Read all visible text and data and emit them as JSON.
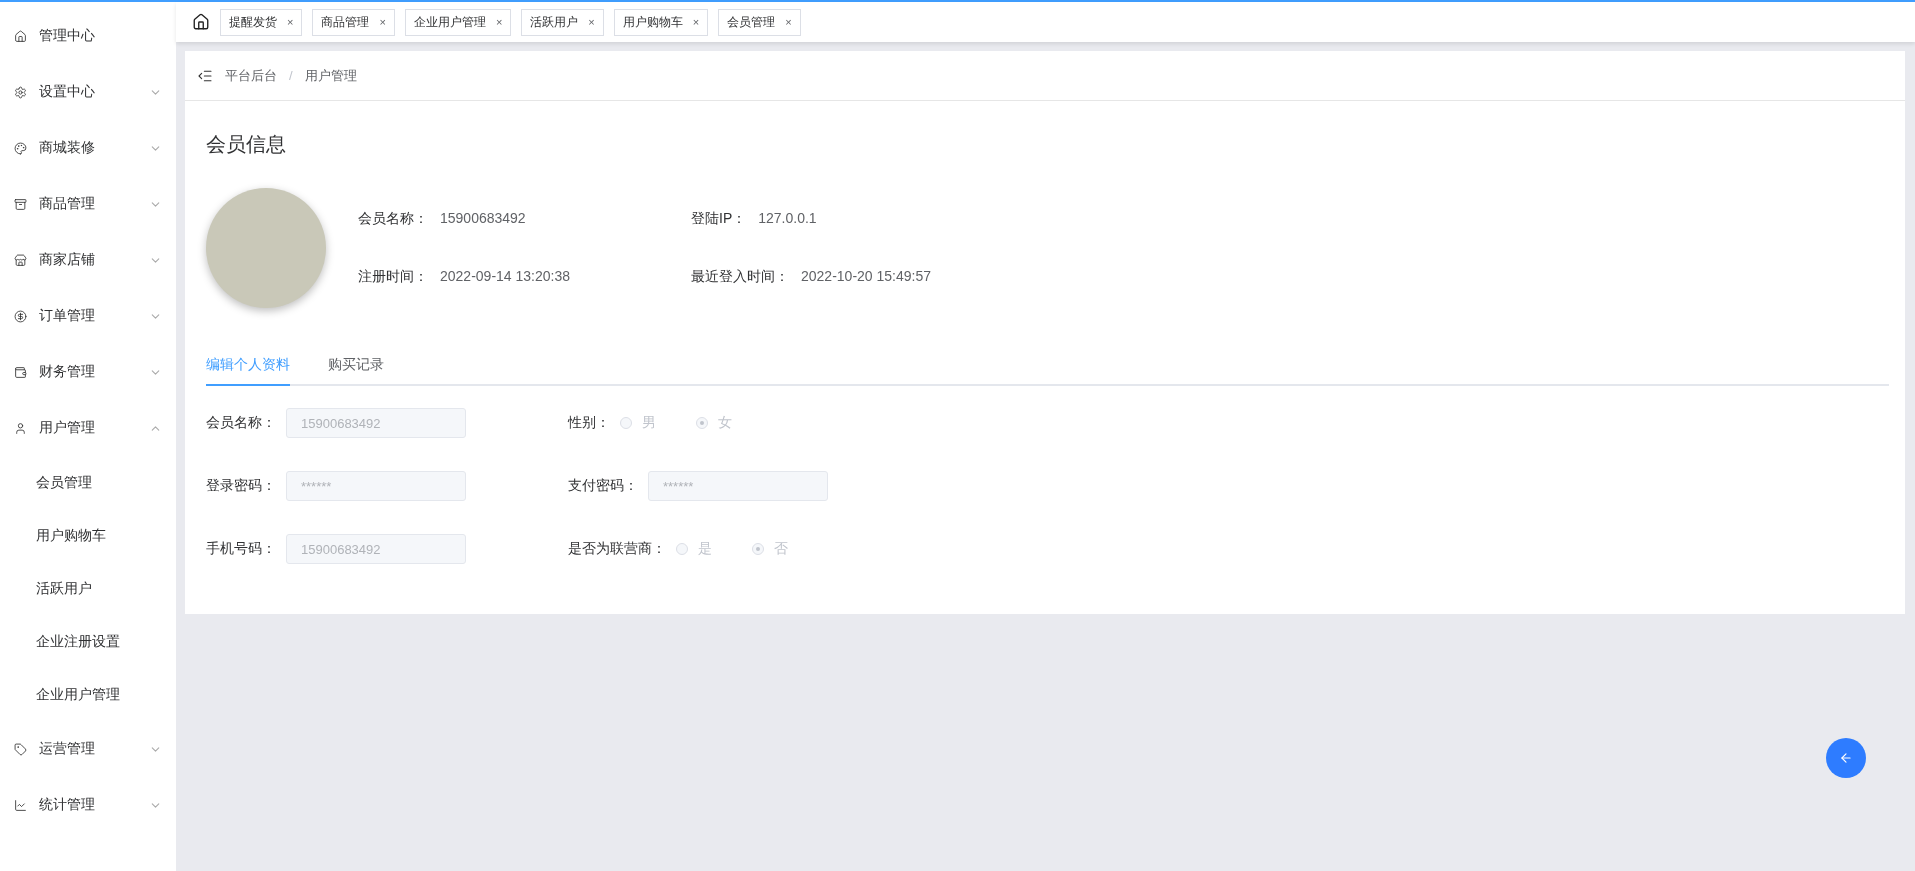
{
  "sidebar": {
    "items": [
      {
        "kind": "link",
        "label": "管理中心"
      },
      {
        "kind": "group",
        "label": "设置中心",
        "expanded": false
      },
      {
        "kind": "group",
        "label": "商城装修",
        "expanded": false
      },
      {
        "kind": "group",
        "label": "商品管理",
        "expanded": false
      },
      {
        "kind": "group",
        "label": "商家店铺",
        "expanded": false
      },
      {
        "kind": "group",
        "label": "订单管理",
        "expanded": false
      },
      {
        "kind": "group",
        "label": "财务管理",
        "expanded": false
      },
      {
        "kind": "group",
        "label": "用户管理",
        "expanded": true,
        "children": [
          {
            "label": "会员管理"
          },
          {
            "label": "用户购物车"
          },
          {
            "label": "活跃用户"
          },
          {
            "label": "企业注册设置"
          },
          {
            "label": "企业用户管理"
          }
        ]
      },
      {
        "kind": "group",
        "label": "运营管理",
        "expanded": false
      },
      {
        "kind": "group",
        "label": "统计管理",
        "expanded": false
      }
    ]
  },
  "tag_tabs": [
    {
      "label": "提醒发货",
      "close": "×"
    },
    {
      "label": "商品管理",
      "close": "×"
    },
    {
      "label": "企业用户管理",
      "close": "×"
    },
    {
      "label": "活跃用户",
      "close": "×"
    },
    {
      "label": "用户购物车",
      "close": "×"
    },
    {
      "label": "会员管理",
      "close": "×"
    }
  ],
  "breadcrumb": [
    "平台后台",
    "用户管理"
  ],
  "breadcrumb_separator": "/",
  "title": "会员信息",
  "info": [
    {
      "label": "会员名称：",
      "value": "15900683492"
    },
    {
      "label": "登陆IP：",
      "value": "127.0.0.1"
    },
    {
      "label": "注册时间：",
      "value": "2022-09-14 13:20:38"
    },
    {
      "label": "最近登入时间：",
      "value": "2022-10-20 15:49:57"
    }
  ],
  "tabs": [
    {
      "label": "编辑个人资料",
      "selected": true
    },
    {
      "label": "购买记录",
      "selected": false
    }
  ],
  "form": [
    {
      "kind": "input",
      "label": "会员名称：",
      "value": "15900683492",
      "disabled": true
    },
    {
      "kind": "radio",
      "label": "性别：",
      "disabled": true,
      "options": [
        {
          "label": "男",
          "selected": false
        },
        {
          "label": "女",
          "selected": true
        }
      ]
    },
    {
      "kind": "input",
      "label": "登录密码：",
      "value": "******",
      "disabled": true
    },
    {
      "kind": "input",
      "label": "支付密码：",
      "value": "******",
      "disabled": true
    },
    {
      "kind": "input",
      "label": "手机号码：",
      "value": "15900683492",
      "disabled": true
    },
    {
      "kind": "radio",
      "label": "是否为联营商：",
      "disabled": true,
      "options": [
        {
          "label": "是",
          "selected": false
        },
        {
          "label": "否",
          "selected": true
        }
      ]
    }
  ]
}
